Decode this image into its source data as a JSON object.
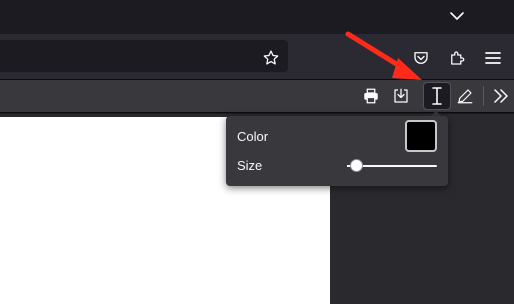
{
  "titlebar": {
    "tabs_menu_icon": "chevron-down-icon"
  },
  "navbar": {
    "url_value": "",
    "bookmark_icon": "star-icon",
    "pocket_icon": "pocket-icon",
    "extensions_icon": "puzzle-icon",
    "menu_icon": "hamburger-menu-icon"
  },
  "pdf_toolbar": {
    "print_icon": "print-icon",
    "save_icon": "download-icon",
    "text_icon": "text-cursor-icon",
    "draw_icon": "pencil-icon",
    "overflow_icon": "double-chevron-right-icon"
  },
  "text_editor_popover": {
    "color_label": "Color",
    "color_value": "#000000",
    "size_label": "Size",
    "size_value": 0.1
  },
  "annotation": {
    "arrow_color": "#ff2a1a"
  },
  "colors": {
    "toolbar_bg": "#2b2a33",
    "pdf_toolbar_bg": "#38383d",
    "popover_bg": "#38383d",
    "page_bg": "#ffffff"
  }
}
